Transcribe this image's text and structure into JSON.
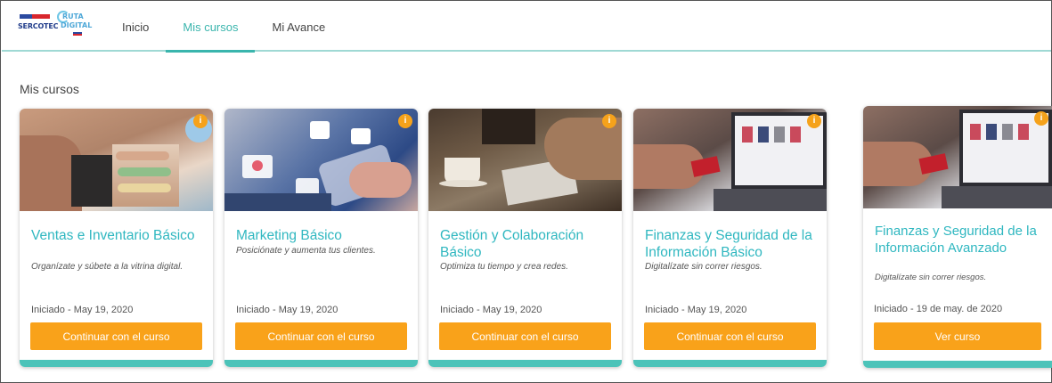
{
  "header": {
    "logo_sercotec": "SERCOTEC",
    "logo_ruta_line1": "RUTA",
    "logo_ruta_line2": "DIGITAL",
    "nav": [
      {
        "label": "Inicio",
        "active": false
      },
      {
        "label": "Mis cursos",
        "active": true
      },
      {
        "label": "Mi Avance",
        "active": false
      }
    ]
  },
  "page_title": "Mis cursos",
  "colors": {
    "accent": "#3ab5ad",
    "title_teal": "#2fb7c0",
    "button_orange": "#f9a21a",
    "info_badge": "#f5a21b",
    "card_bottom_bar": "#4cc3b9"
  },
  "courses": [
    {
      "title": "Ventas e Inventario Básico",
      "subtitle": "Organízate y súbete a la vitrina digital.",
      "status": "Iniciado - May 19, 2020",
      "button": "Continuar con el curso",
      "info_icon": "info-icon",
      "image": "shop-counter-photo"
    },
    {
      "title": "Marketing Básico",
      "subtitle": "Posiciónate y aumenta tus clientes.",
      "status": "Iniciado - May 19, 2020",
      "button": "Continuar con el curso",
      "info_icon": "info-icon",
      "image": "social-media-phone-photo"
    },
    {
      "title": "Gestión y Colaboración Básico",
      "subtitle": "Optimiza tu tiempo y crea redes.",
      "status": "Iniciado - May 19, 2020",
      "button": "Continuar con el curso",
      "info_icon": "info-icon",
      "image": "meeting-coffee-photo"
    },
    {
      "title": "Finanzas y Seguridad de la Información Básico",
      "subtitle": "Digitalízate sin correr riesgos.",
      "status": "Iniciado - May 19, 2020",
      "button": "Continuar con el curso",
      "info_icon": "info-icon",
      "image": "credit-card-laptop-photo"
    },
    {
      "title": "Finanzas y Seguridad de la Información Avanzado",
      "subtitle": "Digitalízate sin correr riesgos.",
      "status": "Iniciado - 19 de may. de 2020",
      "button": "Ver curso",
      "info_icon": "info-icon",
      "image": "credit-card-laptop-photo"
    }
  ]
}
